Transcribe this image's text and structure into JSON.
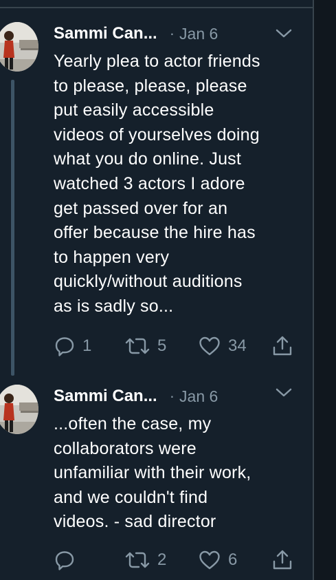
{
  "colors": {
    "background": "#15202b",
    "secondary_text": "#8899a6",
    "divider": "#38444d",
    "thread_line": "#3d5466"
  },
  "tweets": [
    {
      "author_name": "Sammi Can...",
      "separator": "·",
      "date": "Jan 6",
      "text_lines": [
        "Yearly plea to actor friends",
        "to please, please, please",
        "put easily accessible",
        "videos of yourselves doing",
        "what you do online. Just",
        "watched 3 actors I adore",
        "get passed over for an",
        "offer because the hire has",
        "to happen very",
        "quickly/without auditions",
        "as is sadly so..."
      ],
      "reply_count": "1",
      "retweet_count": "5",
      "like_count": "34",
      "icons": [
        "avatar-photo",
        "chevron-down-icon",
        "reply-icon",
        "retweet-icon",
        "like-icon",
        "share-icon"
      ]
    },
    {
      "author_name": "Sammi Can...",
      "separator": "·",
      "date": "Jan 6",
      "text_lines": [
        "...often the case, my",
        "collaborators were",
        "unfamiliar with their work,",
        "and we couldn't find",
        "videos. - sad director"
      ],
      "reply_count": "",
      "retweet_count": "2",
      "like_count": "6",
      "icons": [
        "avatar-photo",
        "chevron-down-icon",
        "reply-icon",
        "retweet-icon",
        "like-icon",
        "share-icon"
      ]
    }
  ]
}
